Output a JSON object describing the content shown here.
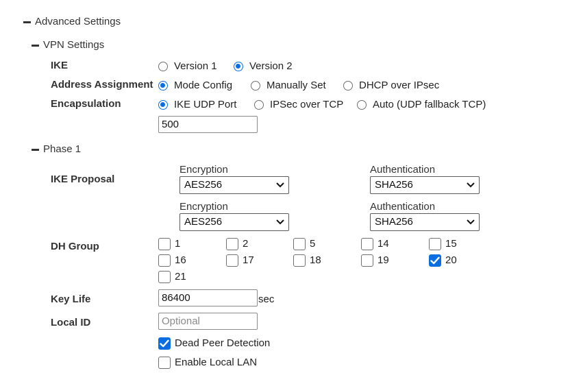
{
  "advanced_settings": {
    "label": "Advanced Settings"
  },
  "vpn_settings": {
    "label": "VPN Settings",
    "ike": {
      "label": "IKE",
      "options": [
        "Version 1",
        "Version 2"
      ],
      "selected": "Version 2"
    },
    "address_assignment": {
      "label": "Address Assignment",
      "options": [
        "Mode Config",
        "Manually Set",
        "DHCP over IPsec"
      ],
      "selected": "Mode Config"
    },
    "encapsulation": {
      "label": "Encapsulation",
      "options": [
        "IKE UDP Port",
        "IPSec over TCP",
        "Auto (UDP fallback TCP)"
      ],
      "selected": "IKE UDP Port",
      "port_value": "500"
    }
  },
  "phase1": {
    "label": "Phase 1",
    "ike_proposal": {
      "label": "IKE Proposal",
      "proposals": [
        {
          "encryption_label": "Encryption",
          "encryption": "AES256",
          "authentication_label": "Authentication",
          "authentication": "SHA256"
        },
        {
          "encryption_label": "Encryption",
          "encryption": "AES256",
          "authentication_label": "Authentication",
          "authentication": "SHA256"
        }
      ]
    },
    "dh_group": {
      "label": "DH Group",
      "groups": [
        {
          "value": "1",
          "checked": false
        },
        {
          "value": "2",
          "checked": false
        },
        {
          "value": "5",
          "checked": false
        },
        {
          "value": "14",
          "checked": false
        },
        {
          "value": "15",
          "checked": false
        },
        {
          "value": "16",
          "checked": false
        },
        {
          "value": "17",
          "checked": false
        },
        {
          "value": "18",
          "checked": false
        },
        {
          "value": "19",
          "checked": false
        },
        {
          "value": "20",
          "checked": true
        },
        {
          "value": "21",
          "checked": false
        }
      ]
    },
    "key_life": {
      "label": "Key Life",
      "value": "86400",
      "unit": "sec"
    },
    "local_id": {
      "label": "Local ID",
      "value": "",
      "placeholder": "Optional"
    },
    "dead_peer_detection": {
      "label": "Dead Peer Detection",
      "checked": true
    },
    "enable_local_lan": {
      "label": "Enable Local LAN",
      "checked": false
    }
  },
  "colors": {
    "accent": "#0a6ee0",
    "text": "#333333",
    "border": "#707070"
  },
  "icons": {
    "collapse": "minus-icon",
    "dropdown": "chevron-down-icon",
    "check": "check-icon"
  }
}
